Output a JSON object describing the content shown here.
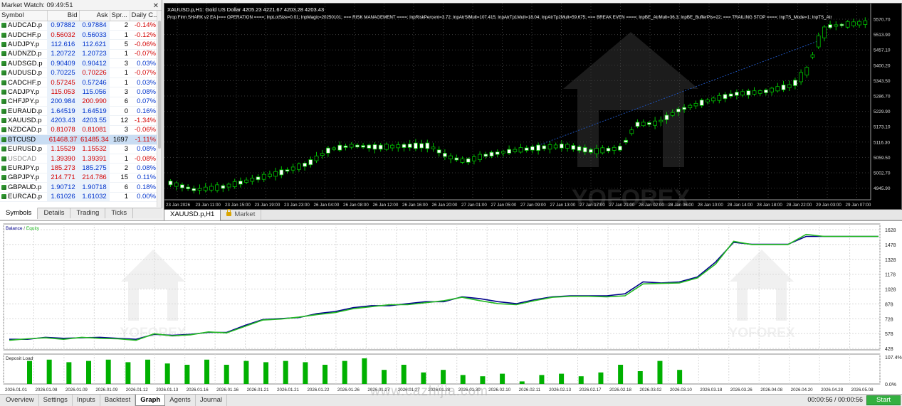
{
  "market_watch": {
    "title": "Market Watch: 09:49:51",
    "close_glyph": "✕",
    "columns": [
      "Symbol",
      "Bid",
      "Ask",
      "Spr...",
      "Daily C..."
    ],
    "rows": [
      {
        "symbol": "AUDCAD.p",
        "bid": "0.97882",
        "ask": "0.97884",
        "spread": "2",
        "change": "-0.14%",
        "dir": "dn"
      },
      {
        "symbol": "AUDCHF.p",
        "bid": "0.56032",
        "ask": "0.56033",
        "spread": "1",
        "change": "-0.12%",
        "dir": "dn",
        "bidRed": true
      },
      {
        "symbol": "AUDJPY.p",
        "bid": "112.616",
        "ask": "112.621",
        "spread": "5",
        "change": "-0.06%",
        "dir": "dn"
      },
      {
        "symbol": "AUDNZD.p",
        "bid": "1.20722",
        "ask": "1.20723",
        "spread": "1",
        "change": "-0.07%",
        "dir": "dn"
      },
      {
        "symbol": "AUDSGD.p",
        "bid": "0.90409",
        "ask": "0.90412",
        "spread": "3",
        "change": "0.03%",
        "dir": "up"
      },
      {
        "symbol": "AUDUSD.p",
        "bid": "0.70225",
        "ask": "0.70226",
        "spread": "1",
        "change": "-0.07%",
        "dir": "dn",
        "askRed": true
      },
      {
        "symbol": "CADCHF.p",
        "bid": "0.57245",
        "ask": "0.57246",
        "spread": "1",
        "change": "0.03%",
        "dir": "up",
        "bidRed": true
      },
      {
        "symbol": "CADJPY.p",
        "bid": "115.053",
        "ask": "115.056",
        "spread": "3",
        "change": "0.08%",
        "dir": "up",
        "bidRed": true
      },
      {
        "symbol": "CHFJPY.p",
        "bid": "200.984",
        "ask": "200.990",
        "spread": "6",
        "change": "0.07%",
        "dir": "up",
        "askRed": true
      },
      {
        "symbol": "EURAUD.p",
        "bid": "1.64519",
        "ask": "1.64519",
        "spread": "0",
        "change": "0.16%",
        "dir": "up"
      },
      {
        "symbol": "XAUUSD.p",
        "bid": "4203.43",
        "ask": "4203.55",
        "spread": "12",
        "change": "-1.34%",
        "dir": "dn"
      },
      {
        "symbol": "NZDCAD.p",
        "bid": "0.81078",
        "ask": "0.81081",
        "spread": "3",
        "change": "-0.06%",
        "dir": "dn",
        "bidRed": true,
        "askRed": true
      },
      {
        "symbol": "BTCUSD",
        "bid": "61468.37",
        "ask": "61485.34",
        "spread": "1697",
        "change": "-1.11%",
        "dir": "dn",
        "selected": true,
        "bidRed": true,
        "askRed": true
      },
      {
        "symbol": "EURUSD.p",
        "bid": "1.15529",
        "ask": "1.15532",
        "spread": "3",
        "change": "0.08%",
        "dir": "up",
        "bidRed": true,
        "askRed": true
      },
      {
        "symbol": "USDCAD",
        "bid": "1.39390",
        "ask": "1.39391",
        "spread": "1",
        "change": "-0.08%",
        "dir": "dn",
        "grey": true,
        "bidRed": true,
        "askRed": true
      },
      {
        "symbol": "EURJPY.p",
        "bid": "185.273",
        "ask": "185.275",
        "spread": "2",
        "change": "0.08%",
        "dir": "up",
        "bidRed": true
      },
      {
        "symbol": "GBPJPY.p",
        "bid": "214.771",
        "ask": "214.786",
        "spread": "15",
        "change": "0.11%",
        "dir": "up",
        "bidRed": true,
        "askRed": true
      },
      {
        "symbol": "GBPAUD.p",
        "bid": "1.90712",
        "ask": "1.90718",
        "spread": "6",
        "change": "0.18%",
        "dir": "up"
      },
      {
        "symbol": "EURCAD.p",
        "bid": "1.61026",
        "ask": "1.61032",
        "spread": "1",
        "change": "0.00%",
        "dir": "up"
      }
    ],
    "tabs": [
      "Symbols",
      "Details",
      "Trading",
      "Ticks"
    ]
  },
  "chart": {
    "info": "XAUUSD.p,H1:  Gold US Dollar  4205.23 4221.67 4203.28 4203.43",
    "ea_text": "Prop Firm SHARK v2 EA |=== OPERATION ====; InpLotSize=0.01; InpMagic=20250101; === RISK MANAGEMENT ====; InpRiskPercent=3.72; InpAtrSlMult=107.415; InpAtrTp1Mult=18.04; InpAtrTp2Mult=59.675; === BREAK EVEN ====; InpBE_AtrMult=36.3; InpBE_BufferPts=22; === TRAILING STOP ====; InpTS_Mode=1; InpTS_Atr",
    "price_labels": [
      "5570.70",
      "5513.90",
      "5457.10",
      "5400.20",
      "5343.50",
      "5286.70",
      "5229.90",
      "5173.10",
      "5116.30",
      "5059.50",
      "5002.70",
      "4945.90"
    ],
    "time_labels": [
      "23 Jan 2026",
      "23 Jan 11:00",
      "23 Jan 15:00",
      "23 Jan 19:00",
      "23 Jan 23:00",
      "26 Jan 04:00",
      "26 Jan 08:00",
      "26 Jan 12:00",
      "26 Jan 16:00",
      "26 Jan 20:00",
      "27 Jan 01:00",
      "27 Jan 05:00",
      "27 Jan 09:00",
      "27 Jan 13:00",
      "27 Jan 17:00",
      "27 Jan 21:00",
      "28 Jan 02:00",
      "28 Jan 06:00",
      "28 Jan 10:00",
      "28 Jan 14:00",
      "28 Jan 18:00",
      "28 Jan 22:00",
      "29 Jan 03:00",
      "29 Jan 07:00"
    ],
    "watermark": "YOFOREX",
    "tabs": [
      "XAUUSD.p,H1",
      "Market"
    ],
    "colors": {
      "bull": "#000000",
      "bear": "#ffffff",
      "wick": "#00c000",
      "trend": "#1e50b4"
    }
  },
  "tester": {
    "legend_balance": "Balance",
    "legend_sep": " / ",
    "legend_equity": "Equity",
    "deposit_label": "Deposit Load",
    "balance_ticks": [
      "1628",
      "1478",
      "1328",
      "1178",
      "1028",
      "878",
      "728",
      "578",
      "428"
    ],
    "load_ticks": [
      "107.4%",
      "0.0%"
    ],
    "date_labels": [
      "2026.01.01",
      "2026.01.08",
      "2026.01.09",
      "2026.01.09",
      "2026.01.12",
      "2026.01.13",
      "2026.01.16",
      "2026.01.16",
      "2026.01.21",
      "2026.01.21",
      "2026.01.22",
      "2026.01.26",
      "2026.01.27",
      "2026.01.27",
      "2026.01.28",
      "2026.01.30",
      "2026.02.10",
      "2026.02.11",
      "2026.02.13",
      "2026.02.17",
      "2026.02.18",
      "2026.03.02",
      "2026.03.10",
      "2026.03.18",
      "2026.03.26",
      "2026.04.08",
      "2026.04.20",
      "2026.04.28",
      "2026.05.08"
    ],
    "colors": {
      "balance": "#00008b",
      "equity": "#22b922",
      "load": "#00b000"
    },
    "watermark": "YOFOREX"
  },
  "chart_data": {
    "type": "line",
    "title": "",
    "xlabel": "",
    "ylabel": "",
    "ylim": [
      428,
      1628
    ],
    "series": [
      {
        "name": "Balance",
        "values": [
          520,
          520,
          540,
          530,
          535,
          540,
          530,
          520,
          570,
          560,
          570,
          590,
          590,
          660,
          720,
          730,
          740,
          780,
          800,
          840,
          860,
          860,
          880,
          900,
          900,
          950,
          930,
          900,
          880,
          920,
          950,
          960,
          960,
          960,
          980,
          1100,
          1090,
          1100,
          1150,
          1300,
          1500,
          1480,
          1480,
          1480,
          1560,
          1560,
          1560,
          1560,
          1560
        ]
      },
      {
        "name": "Equity",
        "values": [
          510,
          525,
          535,
          520,
          540,
          530,
          525,
          510,
          575,
          555,
          565,
          595,
          585,
          650,
          715,
          725,
          745,
          770,
          790,
          830,
          850,
          870,
          870,
          890,
          910,
          945,
          910,
          880,
          870,
          910,
          945,
          955,
          955,
          950,
          960,
          1080,
          1085,
          1090,
          1140,
          1280,
          1510,
          1478,
          1478,
          1478,
          1580,
          1560,
          1560,
          1560,
          1560
        ]
      }
    ],
    "deposit_load": [
      0.9,
      0.95,
      0.85,
      0.9,
      0.95,
      0.85,
      0.95,
      0.8,
      0.75,
      0.95,
      0.75,
      0.9,
      0.85,
      0.9,
      0.85,
      0.75,
      0.9,
      1.0,
      0.55,
      0.75,
      0.45,
      0.55,
      0.35,
      0.3,
      0.4,
      0.1,
      0.35,
      0.4,
      0.3,
      0.45,
      0.75,
      0.5,
      0.9,
      0.55
    ]
  },
  "bottom": {
    "tabs": [
      "Overview",
      "Settings",
      "Inputs",
      "Backtest",
      "Graph",
      "Agents",
      "Journal"
    ],
    "timer": "00:00:56 / 00:00:56",
    "start_label": "Start",
    "site": "www.cazhijia.com"
  }
}
